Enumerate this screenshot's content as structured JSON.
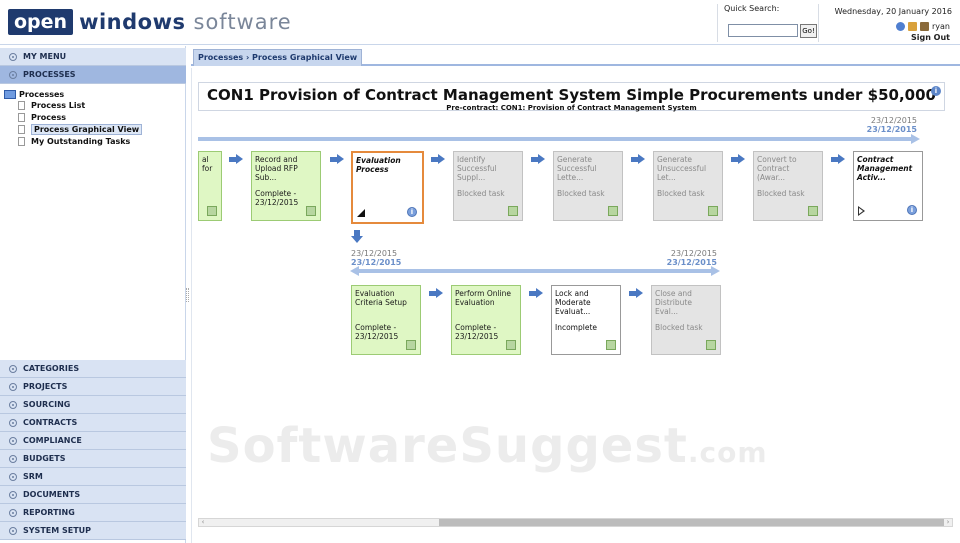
{
  "header": {
    "logo": {
      "open": "open",
      "windows": "windows",
      "software": "software"
    },
    "quick_search": {
      "label": "Quick Search:",
      "value": "",
      "go_label": "Go!"
    },
    "date": "Wednesday, 20 January 2016",
    "user": "ryan",
    "sign_out": "Sign Out"
  },
  "sidebar": {
    "top_sections": [
      {
        "label": "MY MENU"
      },
      {
        "label": "PROCESSES"
      }
    ],
    "tree": {
      "root": "Processes",
      "items": [
        "Process List",
        "Process",
        "Process Graphical View",
        "My Outstanding Tasks"
      ]
    },
    "bottom_sections": [
      "CATEGORIES",
      "PROJECTS",
      "SOURCING",
      "CONTRACTS",
      "COMPLIANCE",
      "BUDGETS",
      "SRM",
      "DOCUMENTS",
      "REPORTING",
      "SYSTEM SETUP"
    ]
  },
  "breadcrumb": "Processes › Process Graphical View",
  "process": {
    "title": "CON1 Provision of Contract Management System Simple Procurements under $50,000",
    "subtitle": "Pre-contract: CON1: Provision of Contract Management System",
    "top_dates": {
      "planned": "23/12/2015",
      "actual": "23/12/2015"
    },
    "sub_dates_left": {
      "planned": "23/12/2015",
      "actual": "23/12/2015"
    },
    "sub_dates_right": {
      "planned": "23/12/2015",
      "actual": "23/12/2015"
    },
    "row1": [
      {
        "name": "al for",
        "status": "",
        "style": "green"
      },
      {
        "name": "Record and Upload RFP Sub...",
        "status": "Complete - 23/12/2015",
        "style": "green"
      },
      {
        "name": "Evaluation Process",
        "status": "",
        "style": "current"
      },
      {
        "name": "Identify Successful Suppl...",
        "status": "Blocked task",
        "style": "grey"
      },
      {
        "name": "Generate Successful Lette...",
        "status": "Blocked task",
        "style": "grey"
      },
      {
        "name": "Generate Unsuccessful Let...",
        "status": "Blocked task",
        "style": "grey"
      },
      {
        "name": "Convert to Contract (Awar...",
        "status": "Blocked task",
        "style": "grey"
      },
      {
        "name": "Contract Management Activ...",
        "status": "",
        "style": "white-it"
      }
    ],
    "row2": [
      {
        "name": "Evaluation Criteria Setup",
        "status": "Complete - 23/12/2015",
        "style": "green"
      },
      {
        "name": "Perform Online Evaluation",
        "status": "Complete - 23/12/2015",
        "style": "green"
      },
      {
        "name": "Lock and Moderate Evaluat...",
        "status": "Incomplete",
        "style": "white"
      },
      {
        "name": "Close and Distribute Eval...",
        "status": "Blocked task",
        "style": "grey"
      }
    ]
  },
  "watermark": {
    "main": "SoftwareSuggest",
    "suffix": ".com"
  },
  "colors": {
    "nav_bg": "#d9e3f3",
    "nav_active": "#9fb7e0",
    "complete": "#dff7c4",
    "current_border": "#e58a3c",
    "blocked": "#e4e4e4",
    "arrow": "#4a78c2"
  }
}
